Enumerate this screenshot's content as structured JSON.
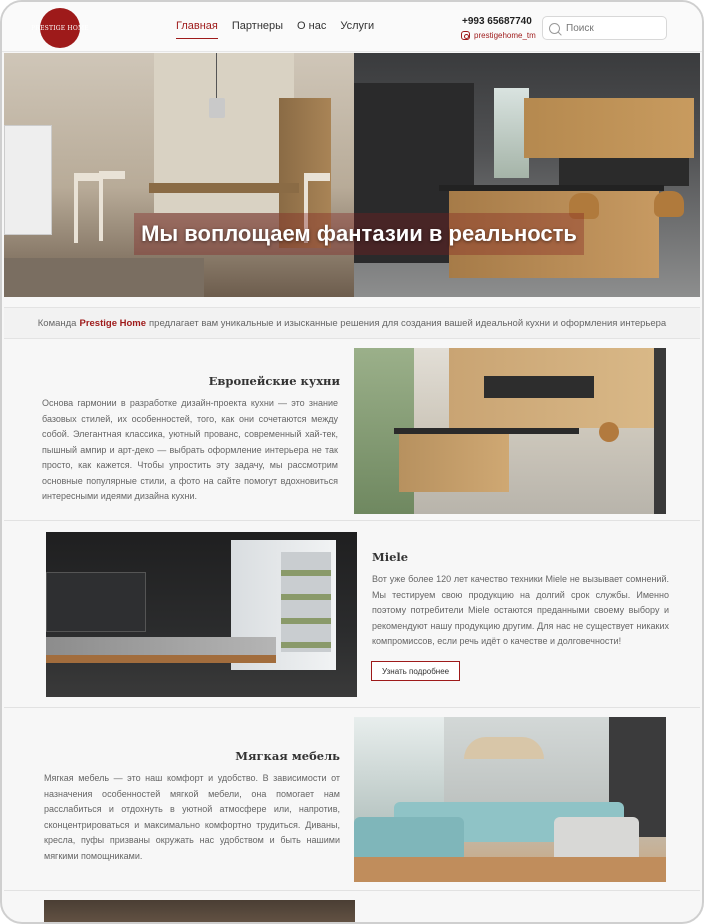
{
  "header": {
    "logo_text": "PRESTIGE HOME",
    "nav": [
      "Главная",
      "Партнеры",
      "О нас",
      "Услуги"
    ],
    "active_nav": "Главная",
    "phone": "+993 65687740",
    "instagram": "prestigehome_tm",
    "instagram_icon": "instagram-icon",
    "search_placeholder": "Поиск",
    "search_icon": "search-icon"
  },
  "hero": {
    "title": "Мы воплощаем фантазии в реальность"
  },
  "intro": {
    "prefix": "Команда",
    "brand": "Prestige Home",
    "suffix": "предлагает вам уникальные и изысканные решения для создания вашей идеальной кухни и оформления интерьера"
  },
  "sections": {
    "european": {
      "title": "Европейские кухни",
      "text": "Основа гармонии в разработке дизайн-проекта кухни — это знание базовых стилей, их особенностей, того, как они сочетаются между собой. Элегантная классика, уютный прованс, современный хай-тек, пышный ампир и арт-деко — выбрать оформление интерьера не так просто, как кажется. Чтобы упростить эту задачу, мы рассмотрим основные популярные стили, а фото на сайте помогут вдохновиться интересными идеями дизайна кухни."
    },
    "miele": {
      "title": "Miele",
      "text": "Вот уже более 120 лет качество техники Miele не вызывает сомнений. Мы тестируем свою продукцию на долгий срок службы. Именно поэтому потребители Miele остаются преданными своему выбору и рекомендуют нашу продукцию другим. Для нас не существует никаких компромиссов, если речь идёт о качестве и долговечности!",
      "button": "Узнать подробнее"
    },
    "soft": {
      "title": "Мягкая мебель",
      "text": "Мягкая мебель — это наш комфорт и удобство. В зависимости от назначения особенностей мягкой мебели, она помогает нам расслабиться и отдохнуть в уютной атмосфере или, напротив, сконцентрироваться и максимально комфортно трудиться. Диваны, кресла, пуфы призваны окружать нас удобством и быть нашими мягкими помощниками."
    }
  },
  "colors": {
    "accent": "#9e1a1a"
  }
}
